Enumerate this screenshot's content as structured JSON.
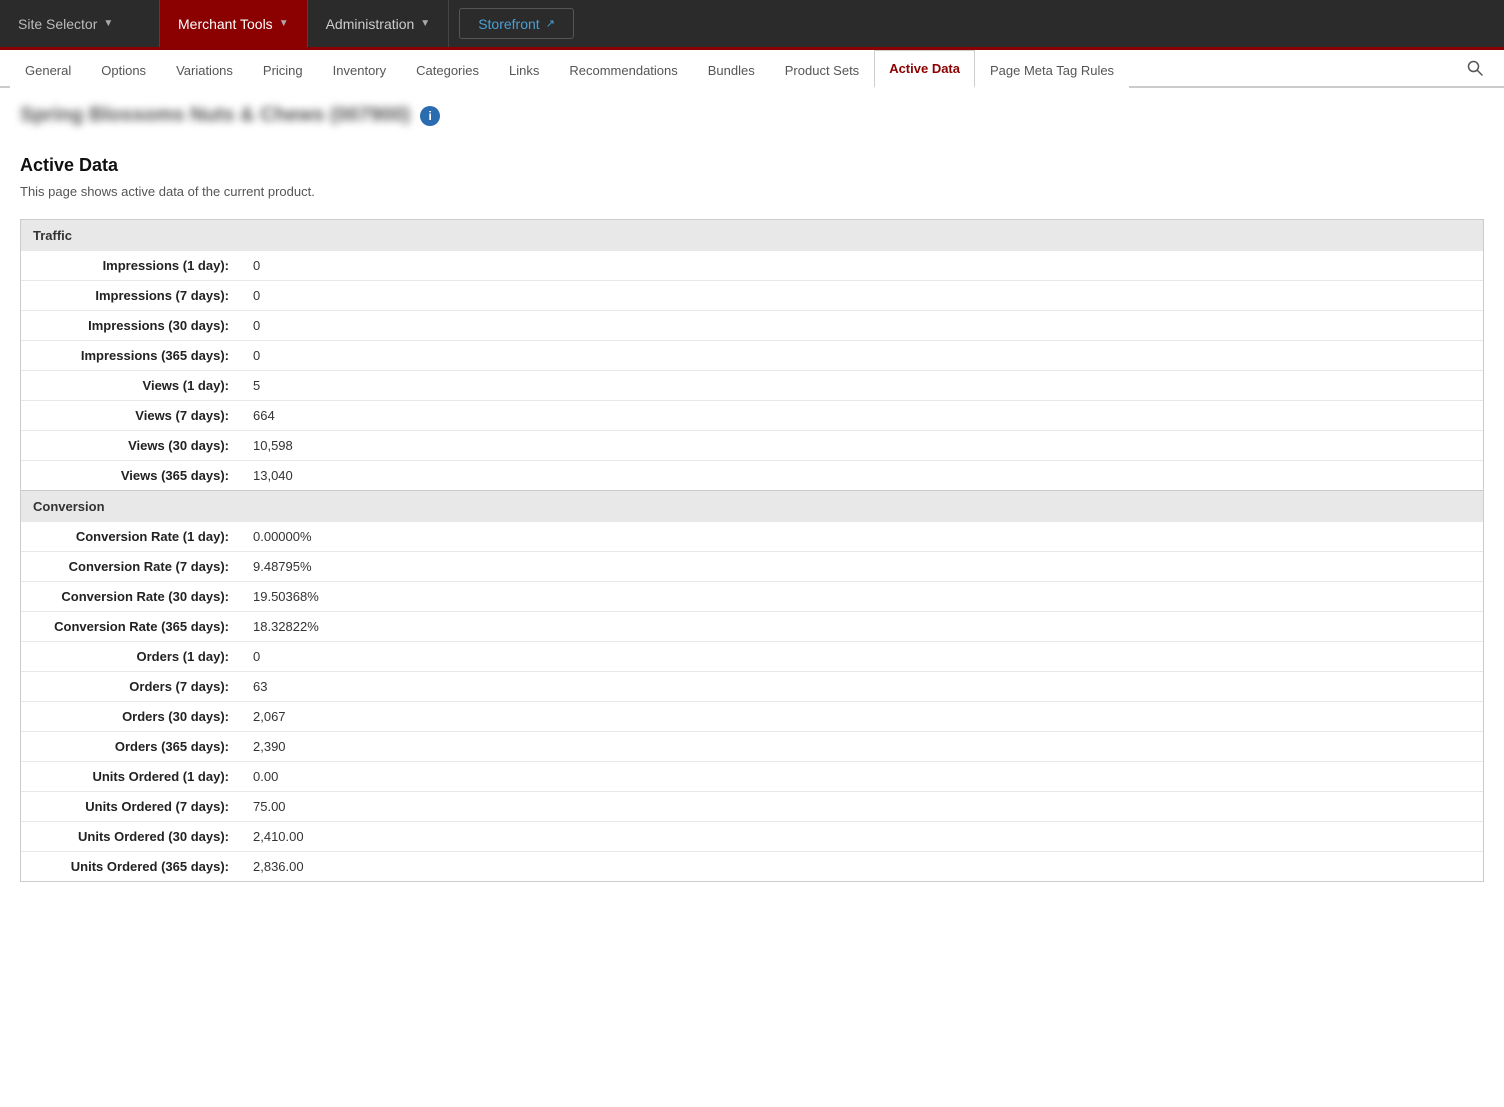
{
  "topNav": {
    "site_label": "Site Selector",
    "merchant_tools_label": "Merchant Tools",
    "administration_label": "Administration",
    "storefront_label": "Storefront"
  },
  "tabs": [
    {
      "id": "general",
      "label": "General"
    },
    {
      "id": "options",
      "label": "Options"
    },
    {
      "id": "variations",
      "label": "Variations"
    },
    {
      "id": "pricing",
      "label": "Pricing"
    },
    {
      "id": "inventory",
      "label": "Inventory"
    },
    {
      "id": "categories",
      "label": "Categories"
    },
    {
      "id": "links",
      "label": "Links"
    },
    {
      "id": "recommendations",
      "label": "Recommendations"
    },
    {
      "id": "bundles",
      "label": "Bundles"
    },
    {
      "id": "product_sets",
      "label": "Product Sets"
    },
    {
      "id": "active_data",
      "label": "Active Data",
      "active": true
    },
    {
      "id": "page_meta_tag_rules",
      "label": "Page Meta Tag Rules"
    }
  ],
  "product": {
    "title": "Spring Blossoms Nuts & Chews (007900)",
    "info_icon_label": "i"
  },
  "page": {
    "heading": "Active Data",
    "description": "This page shows active data of the current product."
  },
  "traffic": {
    "section_label": "Traffic",
    "rows": [
      {
        "label": "Impressions (1 day):",
        "value": "0"
      },
      {
        "label": "Impressions (7 days):",
        "value": "0"
      },
      {
        "label": "Impressions (30 days):",
        "value": "0"
      },
      {
        "label": "Impressions (365 days):",
        "value": "0"
      },
      {
        "label": "Views (1 day):",
        "value": "5"
      },
      {
        "label": "Views (7 days):",
        "value": "664"
      },
      {
        "label": "Views (30 days):",
        "value": "10,598"
      },
      {
        "label": "Views (365 days):",
        "value": "13,040"
      }
    ]
  },
  "conversion": {
    "section_label": "Conversion",
    "rows": [
      {
        "label": "Conversion Rate (1 day):",
        "value": "0.00000%"
      },
      {
        "label": "Conversion Rate (7 days):",
        "value": "9.48795%"
      },
      {
        "label": "Conversion Rate (30 days):",
        "value": "19.50368%"
      },
      {
        "label": "Conversion Rate (365 days):",
        "value": "18.32822%"
      },
      {
        "label": "Orders (1 day):",
        "value": "0"
      },
      {
        "label": "Orders (7 days):",
        "value": "63"
      },
      {
        "label": "Orders (30 days):",
        "value": "2,067"
      },
      {
        "label": "Orders (365 days):",
        "value": "2,390"
      },
      {
        "label": "Units Ordered (1 day):",
        "value": "0.00"
      },
      {
        "label": "Units Ordered (7 days):",
        "value": "75.00"
      },
      {
        "label": "Units Ordered (30 days):",
        "value": "2,410.00"
      },
      {
        "label": "Units Ordered (365 days):",
        "value": "2,836.00"
      }
    ]
  }
}
